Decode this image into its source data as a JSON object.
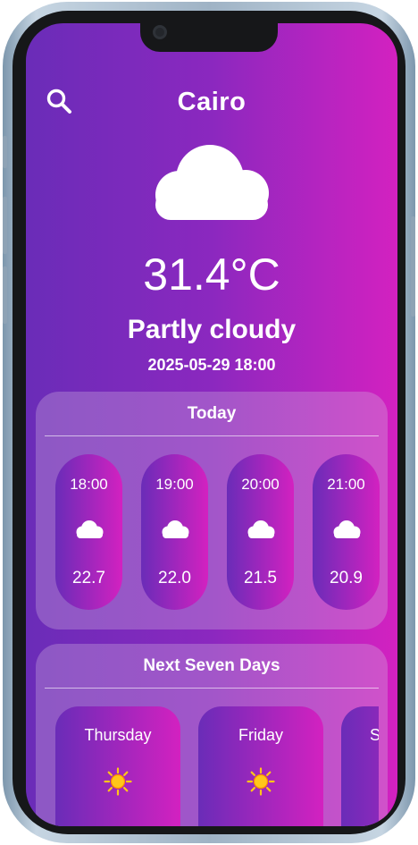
{
  "header": {
    "city": "Cairo",
    "search_icon": "search-icon"
  },
  "current": {
    "icon": "cloud-icon",
    "temperature": "31.4°C",
    "condition": "Partly cloudy",
    "datetime": "2025-05-29 18:00"
  },
  "today": {
    "title": "Today",
    "hours": [
      {
        "time": "18:00",
        "icon": "cloud-icon",
        "temp": "22.7"
      },
      {
        "time": "19:00",
        "icon": "cloud-icon",
        "temp": "22.0"
      },
      {
        "time": "20:00",
        "icon": "cloud-icon",
        "temp": "21.5"
      },
      {
        "time": "21:00",
        "icon": "cloud-icon",
        "temp": "20.9"
      }
    ]
  },
  "week": {
    "title": "Next Seven Days",
    "days": [
      {
        "name": "Thursday",
        "icon": "sun-icon"
      },
      {
        "name": "Friday",
        "icon": "sun-icon"
      },
      {
        "name": "S",
        "icon": "sun-icon"
      }
    ]
  },
  "colors": {
    "gradient_start": "#6a2cb8",
    "gradient_end": "#d321c0",
    "sun": "#ffc61a",
    "text": "#ffffff"
  }
}
